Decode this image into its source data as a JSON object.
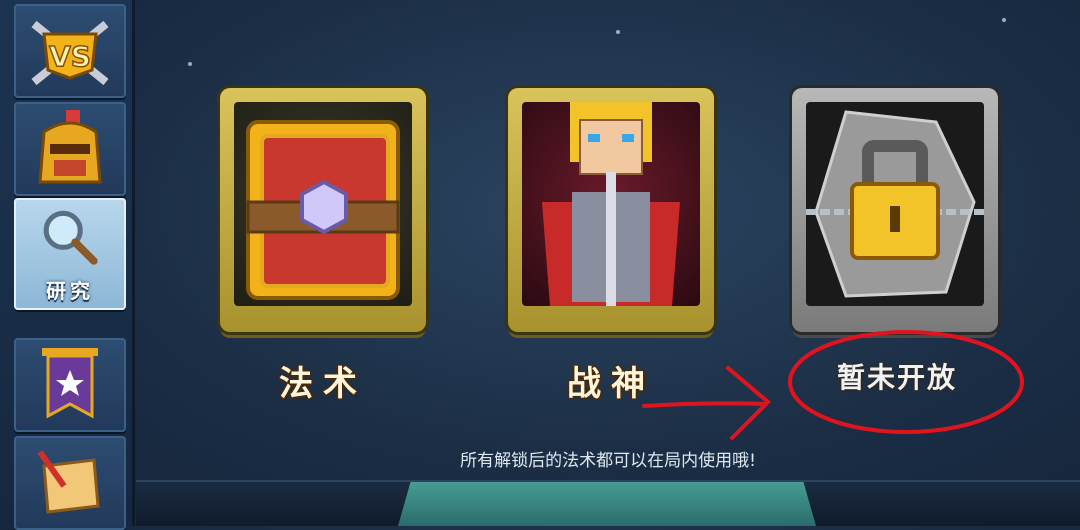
{
  "sidebar": {
    "items": [
      {
        "icon": "vs-crossed-swords-icon",
        "label": ""
      },
      {
        "icon": "knight-helmet-icon",
        "label": ""
      },
      {
        "icon": "magnifying-glass-icon",
        "label": "研究"
      },
      {
        "icon": "purple-banner-icon",
        "label": ""
      },
      {
        "icon": "scroll-quill-icon",
        "label": ""
      }
    ],
    "active_index": 2
  },
  "cards": [
    {
      "label": "法术",
      "icon": "spellbook-icon",
      "locked": false
    },
    {
      "label": "战神",
      "icon": "warrior-hero-icon",
      "locked": false
    },
    {
      "label": "暂未开放",
      "icon": "padlock-icon",
      "locked": true
    }
  ],
  "hint": "所有解锁后的法术都可以在局内使用哦!",
  "colors": {
    "gold_frame": "#c9b24a",
    "silver_frame": "#9a9a9a",
    "annotation_red": "#e0141e",
    "background": "#1b2e45"
  }
}
